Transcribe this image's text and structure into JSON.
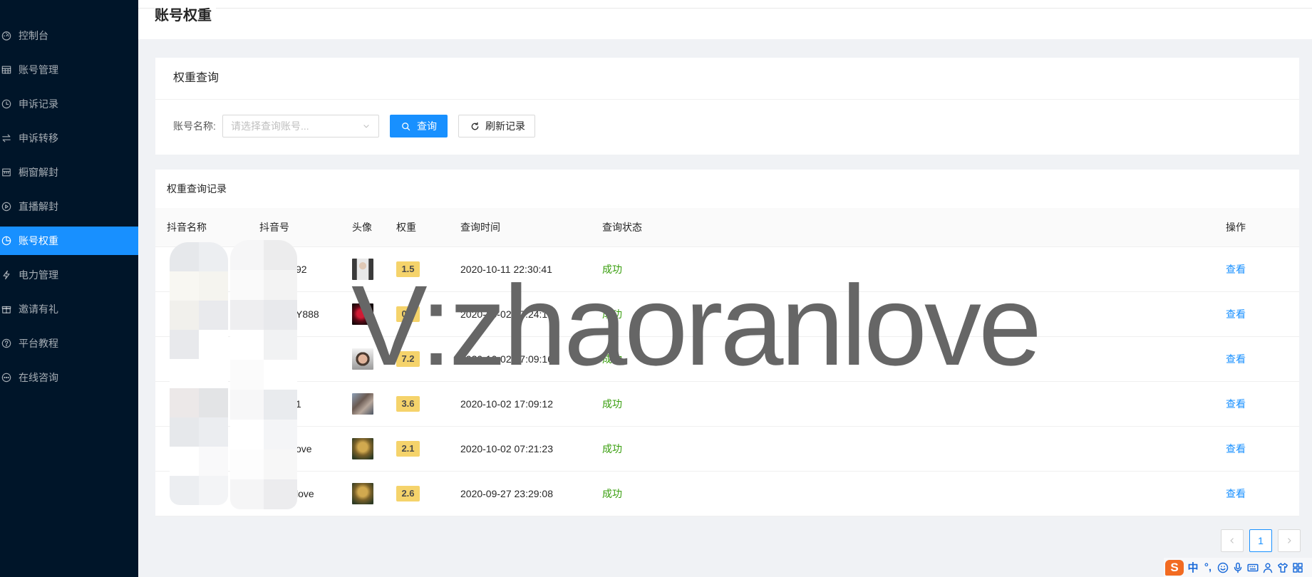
{
  "theme": {
    "primary": "#1890ff",
    "sidebar_bg": "#001529",
    "success": "#389e0d",
    "weight_badge": "#f5d36b"
  },
  "sidebar": {
    "items": [
      {
        "label": "控制台",
        "icon": "dashboard-icon"
      },
      {
        "label": "账号管理",
        "icon": "table-icon"
      },
      {
        "label": "申诉记录",
        "icon": "clock-icon"
      },
      {
        "label": "申诉转移",
        "icon": "swap-icon"
      },
      {
        "label": "橱窗解封",
        "icon": "shop-icon"
      },
      {
        "label": "直播解封",
        "icon": "play-circle-icon"
      },
      {
        "label": "账号权重",
        "icon": "pie-chart-icon"
      },
      {
        "label": "电力管理",
        "icon": "thunderbolt-icon"
      },
      {
        "label": "邀请有礼",
        "icon": "gift-icon"
      },
      {
        "label": "平台教程",
        "icon": "question-circle-icon"
      },
      {
        "label": "在线咨询",
        "icon": "message-icon"
      }
    ]
  },
  "page": {
    "title": "账号权重"
  },
  "query_card": {
    "title": "权重查询",
    "account_label": "账号名称:",
    "account_placeholder": "请选择查询账号...",
    "search_button": "查询",
    "refresh_button": "刷新记录"
  },
  "records_card": {
    "title": "权重查询记录",
    "columns": [
      "抖音名称",
      "抖音号",
      "头像",
      "权重",
      "查询时间",
      "查询状态",
      "操作"
    ],
    "rows": [
      {
        "douyin_id": "92",
        "weight": "1.5",
        "query_time": "2020-10-11 22:30:41",
        "status": "成功",
        "action": "查看"
      },
      {
        "douyin_id": "Y888",
        "weight": "0.7",
        "query_time": "2020-10-02 17:24:17",
        "status": "成功",
        "action": "查看"
      },
      {
        "weight": "7.2",
        "query_time": "2020-10-02 17:09:16",
        "status": "成功",
        "action": "查看"
      },
      {
        "douyin_id": "1",
        "weight": "3.6",
        "query_time": "2020-10-02 17:09:12",
        "status": "成功",
        "action": "查看"
      },
      {
        "douyin_id": "ove",
        "weight": "2.1",
        "query_time": "2020-10-02 07:21:23",
        "status": "成功",
        "action": "查看"
      },
      {
        "douyin_id": "love",
        "weight": "2.6",
        "query_time": "2020-09-27 23:29:08",
        "status": "成功",
        "action": "查看"
      }
    ]
  },
  "pagination": {
    "current_page": "1"
  },
  "watermark": {
    "text": "V:zhaoranlove"
  },
  "ime": {
    "logo": "S",
    "mode": "中",
    "punctuation": "°,"
  }
}
